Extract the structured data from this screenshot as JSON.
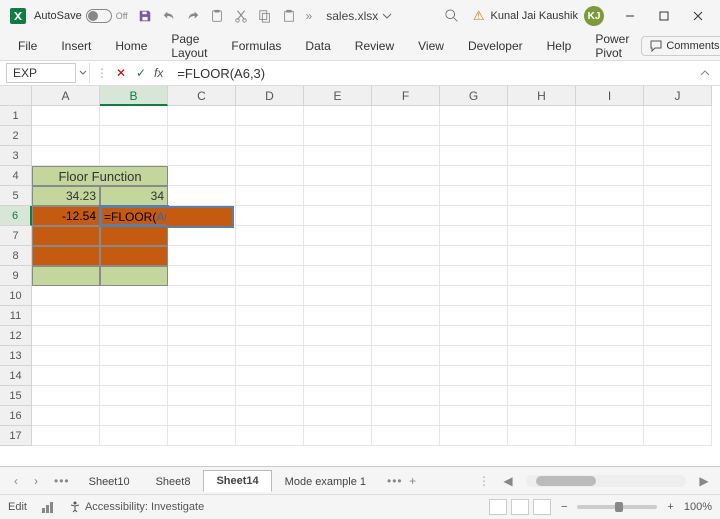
{
  "titlebar": {
    "autosave_label": "AutoSave",
    "autosave_state": "Off",
    "filename": "sales.xlsx",
    "user_name": "Kunal Jai Kaushik",
    "user_initials": "KJ"
  },
  "menu": {
    "file": "File",
    "insert": "Insert",
    "home": "Home",
    "page_layout": "Page Layout",
    "formulas": "Formulas",
    "data": "Data",
    "review": "Review",
    "view": "View",
    "developer": "Developer",
    "help": "Help",
    "power_pivot": "Power Pivot",
    "comments": "Comments"
  },
  "formula_bar": {
    "name_box": "EXP",
    "fx_label": "fx",
    "formula": "=FLOOR(A6,3)",
    "edit_prefix": "=FLOOR(",
    "edit_ref": "A6",
    "edit_suffix": ",3)"
  },
  "columns": [
    "A",
    "B",
    "C",
    "D",
    "E",
    "F",
    "G",
    "H",
    "I",
    "J"
  ],
  "rows": [
    "1",
    "2",
    "3",
    "4",
    "5",
    "6",
    "7",
    "8",
    "9",
    "10",
    "11",
    "12",
    "13",
    "14",
    "15",
    "16",
    "17"
  ],
  "active_col": "B",
  "active_row": "6",
  "cells": {
    "merged_header": "Floor Function",
    "A5": "34.23",
    "B5": "34",
    "A6": "-12.54"
  },
  "tabs": {
    "items": [
      "Sheet10",
      "Sheet8",
      "Sheet14",
      "Mode example 1"
    ],
    "active": "Sheet14",
    "more": "•••"
  },
  "statusbar": {
    "mode": "Edit",
    "accessibility": "Accessibility: Investigate",
    "zoom": "100%"
  }
}
